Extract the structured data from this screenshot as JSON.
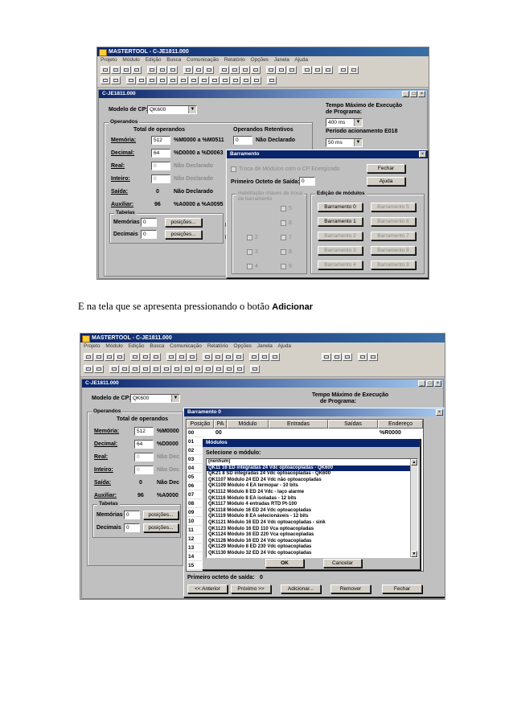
{
  "caption": {
    "text": "E na tela que se apresenta pressionando o botão ",
    "bold": "Adicionar"
  },
  "app": {
    "title": "MASTERTOOL - C-JE1811.000",
    "menu": [
      "Projeto",
      "Módulo",
      "Edição",
      "Busca",
      "Comunicação",
      "Relatório",
      "Opções",
      "Janela",
      "Ajuda"
    ]
  },
  "child": {
    "title": "C-JE1811.000",
    "modelo_label": "Modelo de CP:",
    "modelo_value": "QK600",
    "tempo_label_1": "Tempo Máximo de Execução",
    "tempo_label_2": "de Programa:",
    "tempo_value": "400 ms",
    "periodo_label": "Período acionamento E018",
    "periodo_value": "50 ms",
    "operandos_group": "Operandos",
    "total_label": "Total de operandos",
    "retentivos_label": "Operandos Retentivos",
    "memoria_label": "Memória:",
    "memoria_value": "512",
    "memoria_range": "%M0000 a %M0511",
    "memoria_ret": "0",
    "nao_declarado": "Não Declarado",
    "decimal_label": "Decimal:",
    "decimal_value": "64",
    "decimal_range": "%D0000 a %D0063",
    "real_label": "Real:",
    "real_value": "0",
    "inteiro_label": "Inteiro:",
    "inteiro_value": "0",
    "saida_label": "Saída:",
    "saida_value": "0",
    "auxiliar_label": "Auxiliar:",
    "auxiliar_value": "96",
    "auxiliar_range": "%A0000 a %A0095",
    "tabelas_group": "Tabelas",
    "memorias_label": "Memórias",
    "memorias_value": "0",
    "decimais_label": "Decimais",
    "decimais_value": "0",
    "posicoes_button": "posições...",
    "nao_dec_short": "Não Dec",
    "m0000": "%M0000",
    "d0000": "%D0000",
    "a0000": "%A0000",
    "r_short": "R",
    "in_short": "In"
  },
  "barramento": {
    "title": "Barramento",
    "troca_label": "Troca de Módulos com o CP Energizado",
    "primeiro_label": "Primeiro Octeto de Saída:",
    "primeiro_value": "0",
    "fechar": "Fechar",
    "ajuda": "Ajuda",
    "habilitacao_group": "Habilitação chaves de troca de barramento",
    "chk_labels": [
      "5",
      "6",
      "2",
      "7",
      "3",
      "8",
      "4",
      "9"
    ],
    "edicao_group": "Edição de módulos",
    "buttons": [
      "Barramento 0",
      "Barramento 5",
      "Barramento 1",
      "Barramento 6",
      "Barramento 2",
      "Barramento 7",
      "Barramento 3",
      "Barramento 8",
      "Barramento 4",
      "Barramento 9"
    ]
  },
  "barramento0": {
    "title": "Barramento 0",
    "headers": [
      "Posição",
      "PA",
      "Módulo",
      "Entradas",
      "Saídas",
      "Endereço"
    ],
    "row0_pa": "00",
    "row0_endereco": "%R0000",
    "rows": [
      "00",
      "01",
      "02",
      "03",
      "04",
      "05",
      "06",
      "07",
      "08",
      "09",
      "10",
      "11",
      "12",
      "13",
      "14",
      "15"
    ],
    "primeiro_label": "Primeiro octeto de saída:",
    "primeiro_value": "0",
    "anterior": "<< Anterior",
    "proximo": "Próximo >>",
    "adicionar": "Adicionar...",
    "remover": "Remover",
    "fechar": "Fechar"
  },
  "modulos": {
    "title": "Módulos",
    "selecione": "Selecione o módulo:",
    "items": [
      "(nenhum)",
      "QK11    16 ED integradas 24 Vdc optoacopladas - QK600",
      "QK21    8 SD integradas 24 Vdc optoacopladas - QK600",
      "QK1107  Módulo 24 ED 24 Vdc não optoacopladas",
      "QK1109  Módulo 4 EA termopar - 10 bits",
      "QK1112  Módulo 8 ED 24 Vdc - laço alarme",
      "QK1116  Módulo 8 EA isoladas - 12 bits",
      "QK1117  Módulo 4 entradas RTD Pt-100",
      "QK1118  Módulo 16 ED 24 Vdc optoacopladas",
      "QK1119  Módulo 8 EA selecionáveis - 12 bits",
      "QK1121  Módulo 16 ED 24 Vdc optoacopladas - sink",
      "QK1123  Módulo 16 ED 110 Vca optoacopladas",
      "QK1124  Módulo 16 ED 220 Vca optoacopladas",
      "QK1128  Módulo 16 ED 24 Vdc optoacopladas",
      "QK1129  Módulo 8 ED 230 Vdc optoacopladas",
      "QK1130  Módulo 32 ED 24 Vdc optoacopladas"
    ],
    "ok": "OK",
    "cancelar": "Cancelar"
  }
}
